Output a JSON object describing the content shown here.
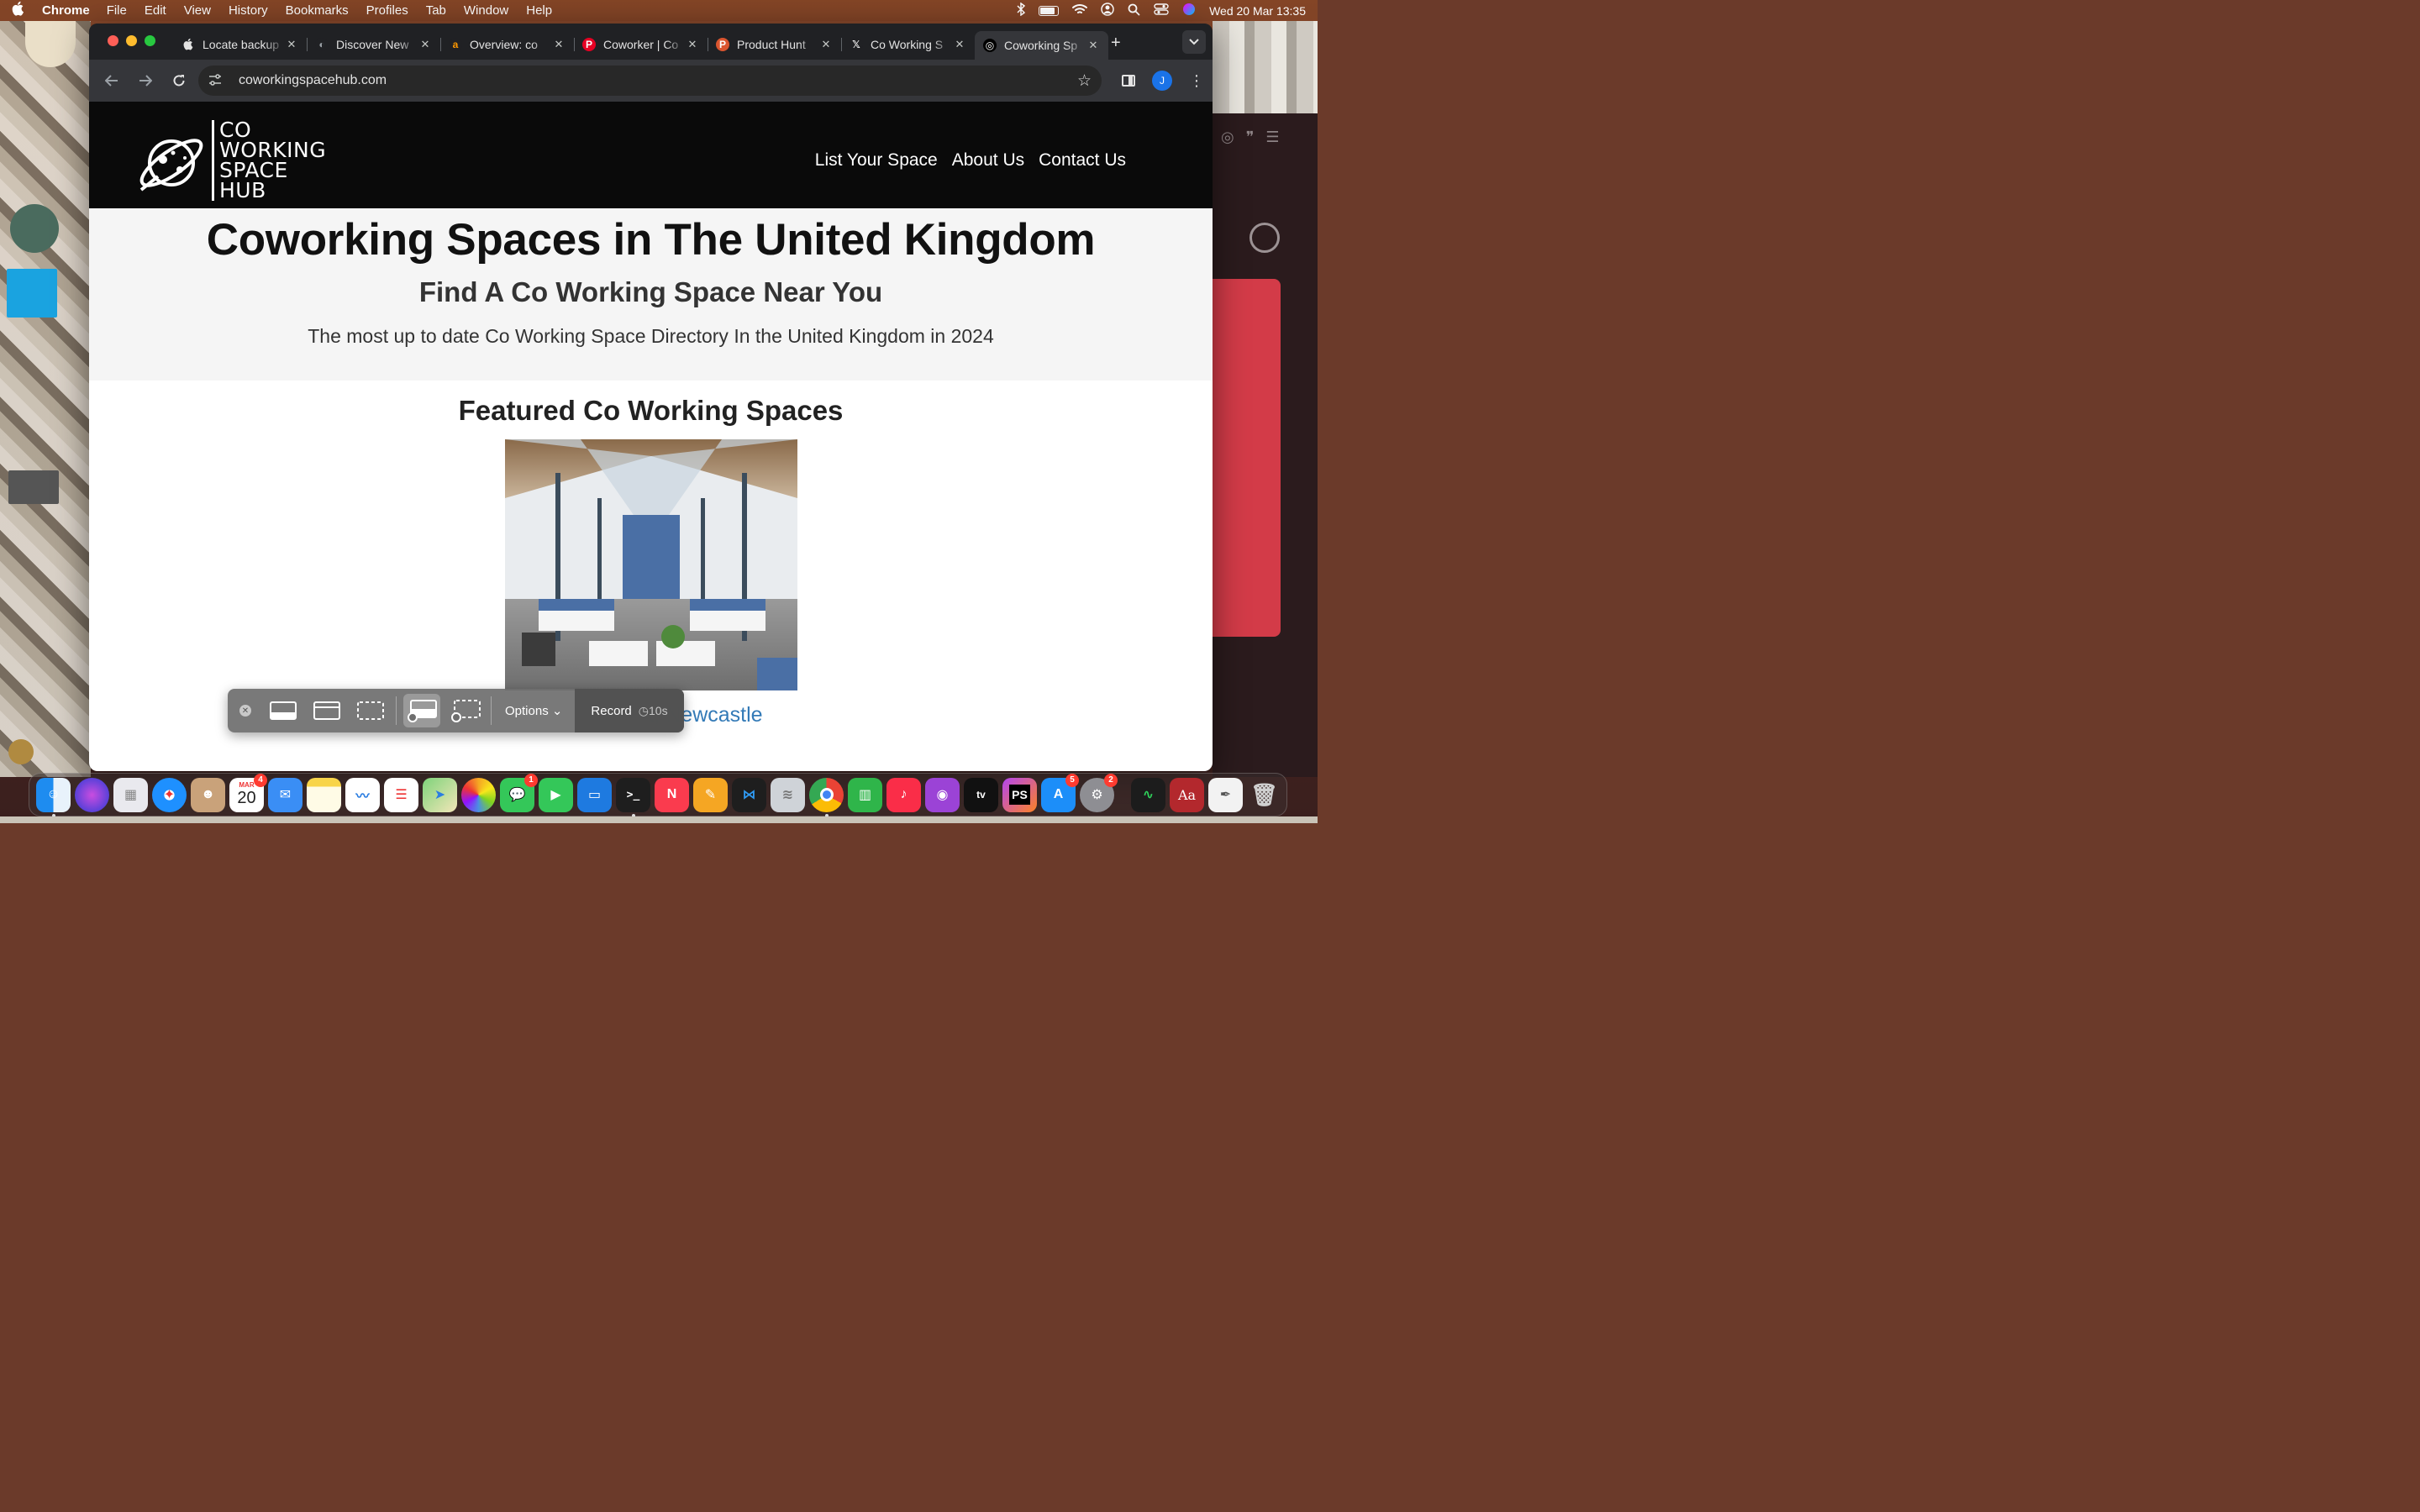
{
  "menubar": {
    "app_name": "Chrome",
    "items": [
      "File",
      "Edit",
      "View",
      "History",
      "Bookmarks",
      "Profiles",
      "Tab",
      "Window",
      "Help"
    ],
    "datetime": "Wed 20 Mar  13:35"
  },
  "browser": {
    "tabs": [
      {
        "title": "Locate backup",
        "favicon": "apple-icon",
        "fav_bg": "#202124",
        "fav_fg": "#e3e3e3",
        "glyph": ""
      },
      {
        "title": "Discover New",
        "favicon": "discover-icon",
        "fav_bg": "#202124",
        "fav_fg": "#9aa0a6",
        "glyph": "◐"
      },
      {
        "title": "Overview: co",
        "favicon": "amazon-icon",
        "fav_bg": "#202124",
        "fav_fg": "#ff9900",
        "glyph": "a"
      },
      {
        "title": "Coworker | Co",
        "favicon": "pinterest-icon",
        "fav_bg": "#e60023",
        "fav_fg": "#ffffff",
        "glyph": "P"
      },
      {
        "title": "Product Hunt",
        "favicon": "producthunt-icon",
        "fav_bg": "#da552f",
        "fav_fg": "#ffffff",
        "glyph": "P"
      },
      {
        "title": "Co Working S",
        "favicon": "x-icon",
        "fav_bg": "#202124",
        "fav_fg": "#ffffff",
        "glyph": "𝕏"
      },
      {
        "title": "Coworking Sp",
        "favicon": "coworking-icon",
        "fav_bg": "#000000",
        "fav_fg": "#ffffff",
        "glyph": "◎",
        "active": true
      }
    ],
    "url": "coworkingspacehub.com",
    "profile_initial": "J"
  },
  "site": {
    "logo_lines": [
      "CO",
      "WORKING",
      "SPACE",
      "HUB"
    ],
    "nav": [
      "List Your Space",
      "About Us",
      "Contact Us"
    ],
    "hero_title": "Coworking Spaces in The United Kingdom",
    "hero_subtitle": "Find A Co Working Space Near You",
    "hero_text": "The most up to date Co Working Space Directory In the United Kingdom in 2024",
    "featured_heading": "Featured Co Working Spaces",
    "featured_link": "t, Newcastle"
  },
  "screenshot_toolbar": {
    "options_label": "Options",
    "record_label": "Record",
    "timer_label": "10s"
  },
  "dock": {
    "calendar_month": "MAR",
    "calendar_day": "20",
    "badges": {
      "calendar": "4",
      "messages": "1",
      "appstore": "5",
      "settings": "2"
    }
  },
  "colors": {
    "link": "#337ab7",
    "header_bg": "#0a0a0a",
    "hero_bg": "#f5f5f5"
  }
}
